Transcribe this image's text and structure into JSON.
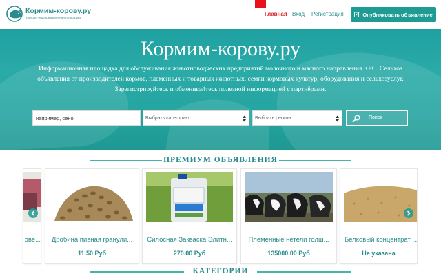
{
  "header": {
    "logo_title": "Кормим-корову.ру",
    "logo_subtitle": "Торгово-информационная площадка",
    "nav": {
      "home": "Главная",
      "login": "Вход",
      "register": "Регистрация"
    },
    "publish_button": "Опубликовать объявление",
    "colors": {
      "accent": "#1e9c94",
      "active": "#d9242c"
    }
  },
  "hero": {
    "title": "Кормим-корову.ру",
    "description": "Информационная площадка для обслуживания животноводческих предприятий молочного и мясного направления КРС. Сельхоз объявления от производителей кормов, племенных и товарных животных, семян кормовых культур, оборудования и сельхозуслуг. Зарегистрируйтесь и обменивайтесь полезной информацией с партнёрами.",
    "search": {
      "value": "например, сено",
      "category_select": "Выбрать категорию",
      "region_select": "Выбрать регион",
      "button": "Поиск",
      "button_icon": "search-icon"
    }
  },
  "premium": {
    "heading": "ПРЕМИУМ ОБЪЯВЛЕНИЯ",
    "cards": [
      {
        "title": "ове...",
        "price": ""
      },
      {
        "title": "Дробина пивная гранули...",
        "price": "11.50 Руб"
      },
      {
        "title": "Силосная Закваска Элитн...",
        "price": "270.00 Руб"
      },
      {
        "title": "Племенные нетели голш...",
        "price": "135000.00 Руб"
      },
      {
        "title": "Белковый концентрат ...",
        "price": "Не указана"
      }
    ]
  },
  "categories": {
    "heading": "КАТЕГОРИИ"
  }
}
